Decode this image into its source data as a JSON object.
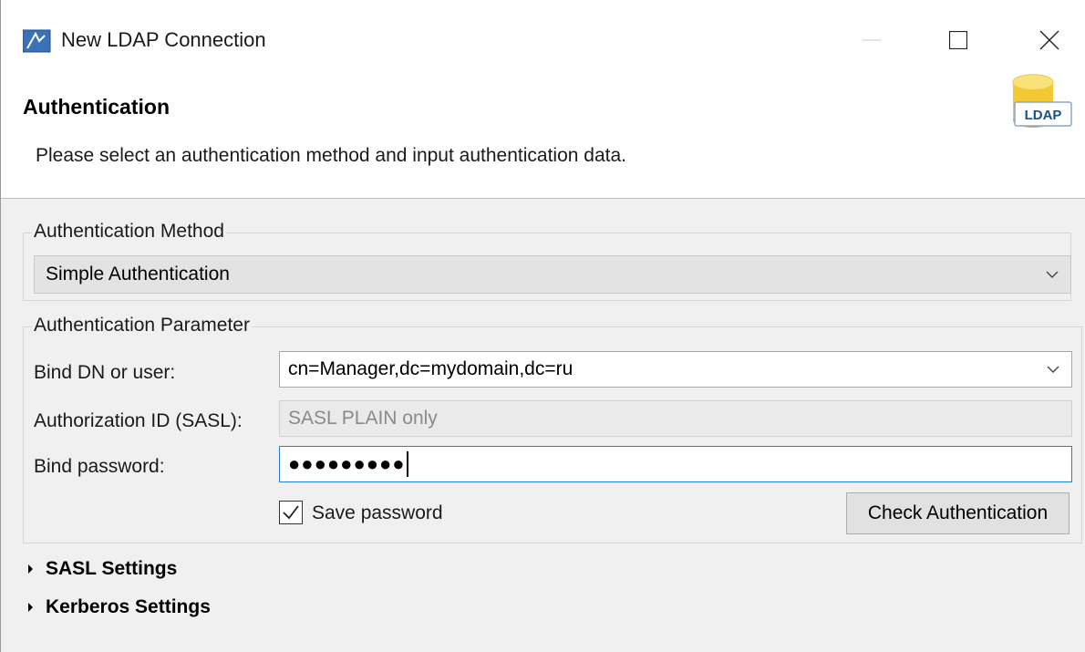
{
  "window": {
    "title": "New LDAP Connection",
    "icon": "ldap-app-icon"
  },
  "header": {
    "title": "Authentication",
    "description": "Please select an authentication method and input authentication data.",
    "logo_text": "LDAP"
  },
  "method_group": {
    "legend": "Authentication Method",
    "selected": "Simple Authentication"
  },
  "param_group": {
    "legend": "Authentication Parameter",
    "bind_dn_label": "Bind DN or user:",
    "bind_dn_value": "cn=Manager,dc=mydomain,dc=ru",
    "authz_label": "Authorization ID (SASL):",
    "authz_placeholder": "SASL PLAIN only",
    "password_label": "Bind password:",
    "password_masked": "●●●●●●●●●",
    "save_password_label": "Save password",
    "save_password_checked": true,
    "check_button": "Check Authentication"
  },
  "sections": {
    "sasl": "SASL Settings",
    "kerberos": "Kerberos Settings"
  },
  "colors": {
    "focus_border": "#2a7fd4",
    "logo_blue": "#1a4f8a",
    "logo_gold": "#e8b820"
  }
}
